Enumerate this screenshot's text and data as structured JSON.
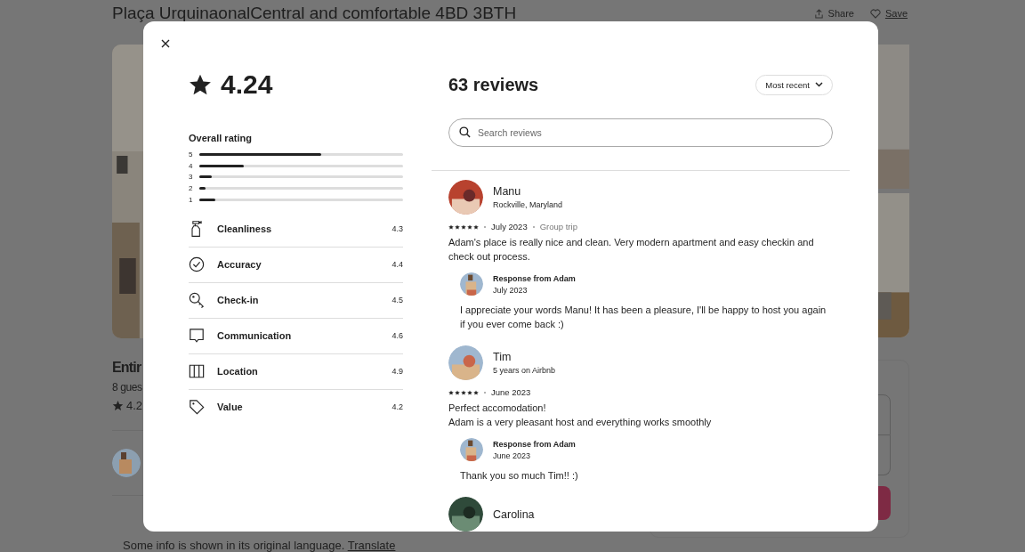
{
  "page": {
    "title": "Plaça UrquinaonalCentral and comfortable 4BD 3BTH",
    "actions": [
      {
        "kind": "share",
        "label": "Share"
      },
      {
        "kind": "save",
        "label": "Save"
      }
    ],
    "listing_type": "Entir",
    "guests": "8 gues",
    "rating": "4.2",
    "language_note": "Some info is shown in its original language.",
    "translate_link": "Translate"
  },
  "modal": {
    "rating": "4.24",
    "overall_label": "Overall rating",
    "distribution": [
      {
        "label": "5",
        "level": 0.6
      },
      {
        "label": "4",
        "level": 0.22
      },
      {
        "label": "3",
        "level": 0.06
      },
      {
        "label": "2",
        "level": 0.03
      },
      {
        "label": "1",
        "level": 0.08
      }
    ],
    "categories": [
      {
        "kind": "cleanliness",
        "name": "Cleanliness",
        "score": "4.3"
      },
      {
        "kind": "accuracy",
        "name": "Accuracy",
        "score": "4.4"
      },
      {
        "kind": "checkin",
        "name": "Check-in",
        "score": "4.5"
      },
      {
        "kind": "communication",
        "name": "Communication",
        "score": "4.6"
      },
      {
        "kind": "location",
        "name": "Location",
        "score": "4.9"
      },
      {
        "kind": "value",
        "name": "Value",
        "score": "4.2"
      }
    ],
    "reviews_count": "63 reviews",
    "sort": "Most recent",
    "search": {
      "placeholder": "Search reviews"
    },
    "reviews": [
      {
        "name": "Manu",
        "subtitle": "Rockville, Maryland",
        "stars": 5,
        "date": "July 2023",
        "trip": "Group trip",
        "text": "Adam's place is really nice and clean. Very modern apartment and easy checkin and check out process.",
        "response": {
          "title": "Response from Adam",
          "date": "July 2023",
          "text": "I appreciate your words Manu! It has been a pleasure, I'll be happy to host you again if you ever come back :)"
        }
      },
      {
        "name": "Tim",
        "subtitle": "5 years on Airbnb",
        "stars": 5,
        "date": "June 2023",
        "text": "Perfect accomodation!\nAdam is a very pleasant host and everything works smoothly",
        "response": {
          "title": "Response from Adam",
          "date": "June 2023",
          "text": "Thank you so much Tim!! :)"
        }
      },
      {
        "name": "Carolina"
      }
    ]
  }
}
